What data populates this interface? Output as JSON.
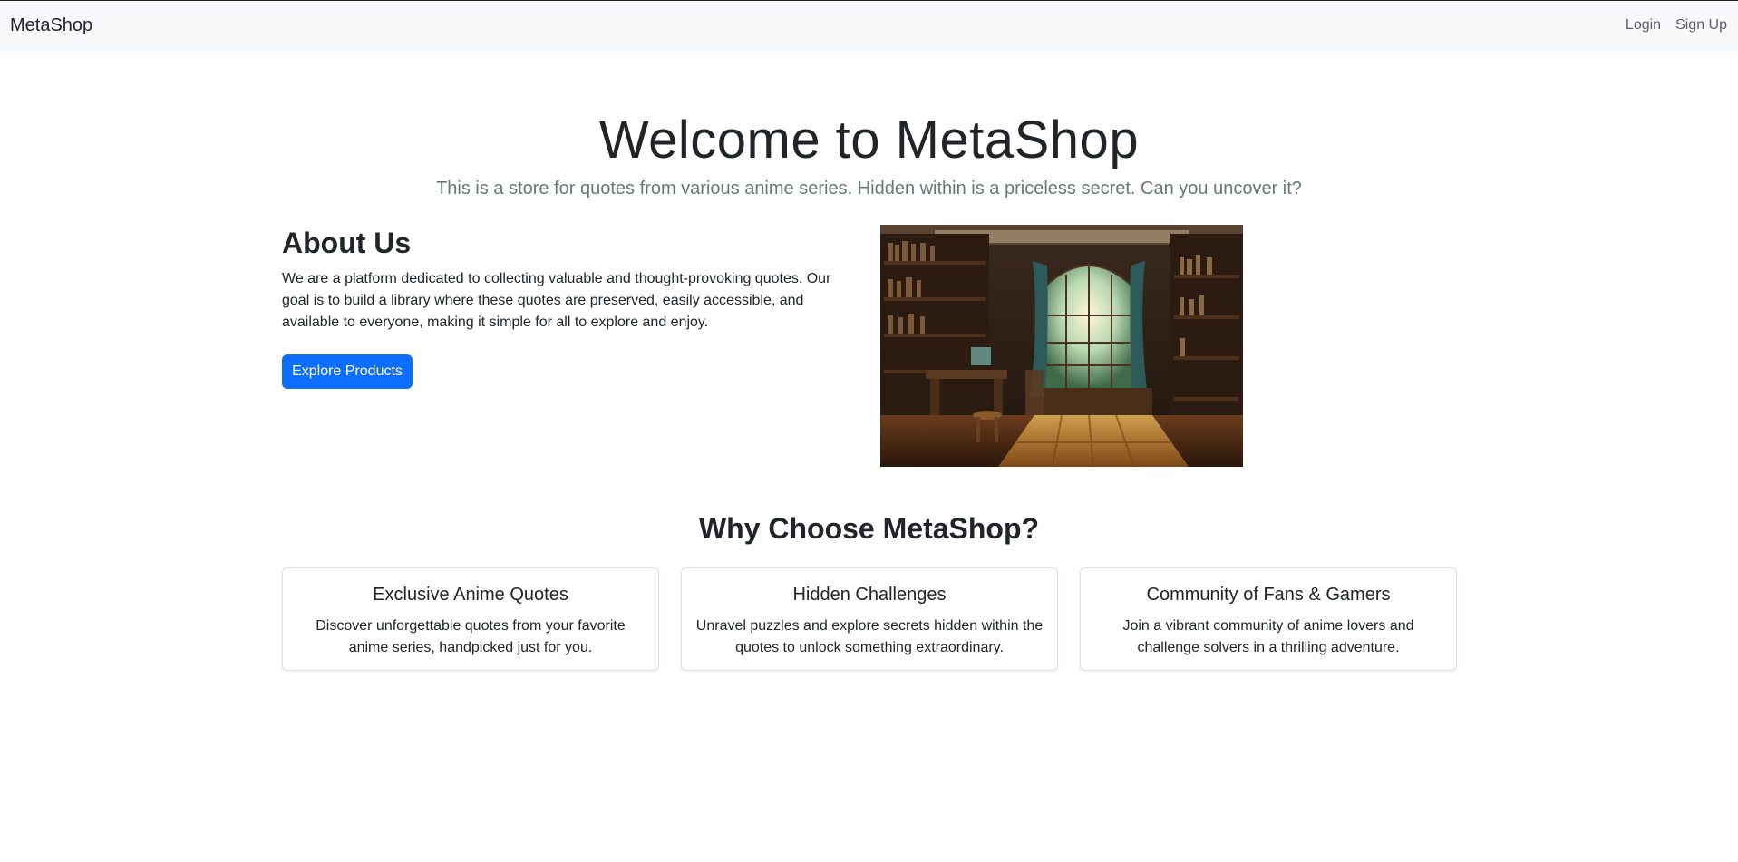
{
  "navbar": {
    "brand": "MetaShop",
    "links": [
      {
        "label": "Login"
      },
      {
        "label": "Sign Up"
      }
    ]
  },
  "hero": {
    "title": "Welcome to MetaShop",
    "lead": "This is a store for quotes from various anime series. Hidden within is a priceless secret. Can you uncover it?"
  },
  "about": {
    "title": "About Us",
    "text": "We are a platform dedicated to collecting valuable and thought-provoking quotes. Our goal is to build a library where these quotes are preserved, easily accessible, and available to everyone, making it simple for all to explore and enjoy.",
    "button_label": "Explore Products",
    "image_name": "anime-library-illustration"
  },
  "why": {
    "title": "Why Choose MetaShop?",
    "cards": [
      {
        "title": "Exclusive Anime Quotes",
        "text": "Discover unforgettable quotes from your favorite anime series, handpicked just for you."
      },
      {
        "title": "Hidden Challenges",
        "text": "Unravel puzzles and explore secrets hidden within the quotes to unlock something extraordinary."
      },
      {
        "title": "Community of Fans & Gamers",
        "text": "Join a vibrant community of anime lovers and challenge solvers in a thrilling adventure."
      }
    ]
  },
  "colors": {
    "primary": "#0d6efd",
    "navbar_bg": "#f8f9fa",
    "muted_text": "#6c757d"
  }
}
